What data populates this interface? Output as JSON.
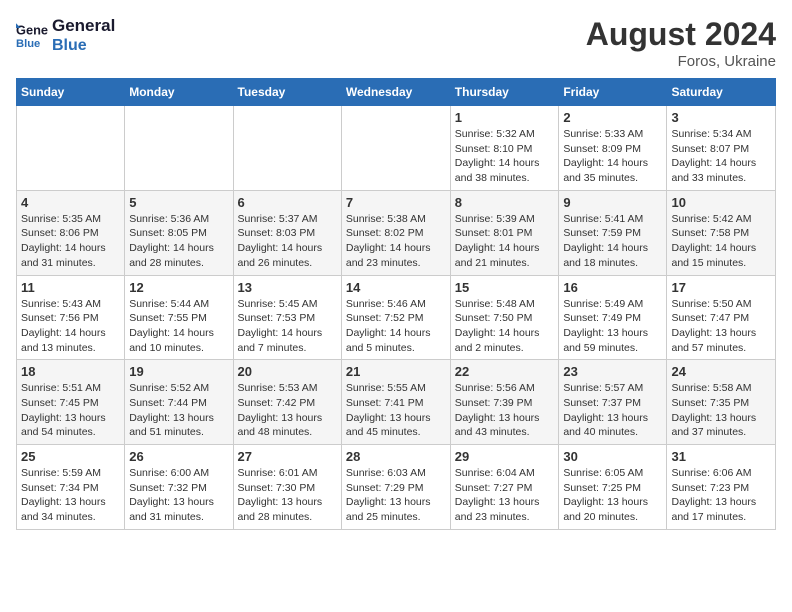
{
  "header": {
    "logo_line1": "General",
    "logo_line2": "Blue",
    "month_year": "August 2024",
    "location": "Foros, Ukraine"
  },
  "weekdays": [
    "Sunday",
    "Monday",
    "Tuesday",
    "Wednesday",
    "Thursday",
    "Friday",
    "Saturday"
  ],
  "weeks": [
    [
      {
        "num": "",
        "sunrise": "",
        "sunset": "",
        "daylight": ""
      },
      {
        "num": "",
        "sunrise": "",
        "sunset": "",
        "daylight": ""
      },
      {
        "num": "",
        "sunrise": "",
        "sunset": "",
        "daylight": ""
      },
      {
        "num": "",
        "sunrise": "",
        "sunset": "",
        "daylight": ""
      },
      {
        "num": "1",
        "sunrise": "Sunrise: 5:32 AM",
        "sunset": "Sunset: 8:10 PM",
        "daylight": "Daylight: 14 hours and 38 minutes."
      },
      {
        "num": "2",
        "sunrise": "Sunrise: 5:33 AM",
        "sunset": "Sunset: 8:09 PM",
        "daylight": "Daylight: 14 hours and 35 minutes."
      },
      {
        "num": "3",
        "sunrise": "Sunrise: 5:34 AM",
        "sunset": "Sunset: 8:07 PM",
        "daylight": "Daylight: 14 hours and 33 minutes."
      }
    ],
    [
      {
        "num": "4",
        "sunrise": "Sunrise: 5:35 AM",
        "sunset": "Sunset: 8:06 PM",
        "daylight": "Daylight: 14 hours and 31 minutes."
      },
      {
        "num": "5",
        "sunrise": "Sunrise: 5:36 AM",
        "sunset": "Sunset: 8:05 PM",
        "daylight": "Daylight: 14 hours and 28 minutes."
      },
      {
        "num": "6",
        "sunrise": "Sunrise: 5:37 AM",
        "sunset": "Sunset: 8:03 PM",
        "daylight": "Daylight: 14 hours and 26 minutes."
      },
      {
        "num": "7",
        "sunrise": "Sunrise: 5:38 AM",
        "sunset": "Sunset: 8:02 PM",
        "daylight": "Daylight: 14 hours and 23 minutes."
      },
      {
        "num": "8",
        "sunrise": "Sunrise: 5:39 AM",
        "sunset": "Sunset: 8:01 PM",
        "daylight": "Daylight: 14 hours and 21 minutes."
      },
      {
        "num": "9",
        "sunrise": "Sunrise: 5:41 AM",
        "sunset": "Sunset: 7:59 PM",
        "daylight": "Daylight: 14 hours and 18 minutes."
      },
      {
        "num": "10",
        "sunrise": "Sunrise: 5:42 AM",
        "sunset": "Sunset: 7:58 PM",
        "daylight": "Daylight: 14 hours and 15 minutes."
      }
    ],
    [
      {
        "num": "11",
        "sunrise": "Sunrise: 5:43 AM",
        "sunset": "Sunset: 7:56 PM",
        "daylight": "Daylight: 14 hours and 13 minutes."
      },
      {
        "num": "12",
        "sunrise": "Sunrise: 5:44 AM",
        "sunset": "Sunset: 7:55 PM",
        "daylight": "Daylight: 14 hours and 10 minutes."
      },
      {
        "num": "13",
        "sunrise": "Sunrise: 5:45 AM",
        "sunset": "Sunset: 7:53 PM",
        "daylight": "Daylight: 14 hours and 7 minutes."
      },
      {
        "num": "14",
        "sunrise": "Sunrise: 5:46 AM",
        "sunset": "Sunset: 7:52 PM",
        "daylight": "Daylight: 14 hours and 5 minutes."
      },
      {
        "num": "15",
        "sunrise": "Sunrise: 5:48 AM",
        "sunset": "Sunset: 7:50 PM",
        "daylight": "Daylight: 14 hours and 2 minutes."
      },
      {
        "num": "16",
        "sunrise": "Sunrise: 5:49 AM",
        "sunset": "Sunset: 7:49 PM",
        "daylight": "Daylight: 13 hours and 59 minutes."
      },
      {
        "num": "17",
        "sunrise": "Sunrise: 5:50 AM",
        "sunset": "Sunset: 7:47 PM",
        "daylight": "Daylight: 13 hours and 57 minutes."
      }
    ],
    [
      {
        "num": "18",
        "sunrise": "Sunrise: 5:51 AM",
        "sunset": "Sunset: 7:45 PM",
        "daylight": "Daylight: 13 hours and 54 minutes."
      },
      {
        "num": "19",
        "sunrise": "Sunrise: 5:52 AM",
        "sunset": "Sunset: 7:44 PM",
        "daylight": "Daylight: 13 hours and 51 minutes."
      },
      {
        "num": "20",
        "sunrise": "Sunrise: 5:53 AM",
        "sunset": "Sunset: 7:42 PM",
        "daylight": "Daylight: 13 hours and 48 minutes."
      },
      {
        "num": "21",
        "sunrise": "Sunrise: 5:55 AM",
        "sunset": "Sunset: 7:41 PM",
        "daylight": "Daylight: 13 hours and 45 minutes."
      },
      {
        "num": "22",
        "sunrise": "Sunrise: 5:56 AM",
        "sunset": "Sunset: 7:39 PM",
        "daylight": "Daylight: 13 hours and 43 minutes."
      },
      {
        "num": "23",
        "sunrise": "Sunrise: 5:57 AM",
        "sunset": "Sunset: 7:37 PM",
        "daylight": "Daylight: 13 hours and 40 minutes."
      },
      {
        "num": "24",
        "sunrise": "Sunrise: 5:58 AM",
        "sunset": "Sunset: 7:35 PM",
        "daylight": "Daylight: 13 hours and 37 minutes."
      }
    ],
    [
      {
        "num": "25",
        "sunrise": "Sunrise: 5:59 AM",
        "sunset": "Sunset: 7:34 PM",
        "daylight": "Daylight: 13 hours and 34 minutes."
      },
      {
        "num": "26",
        "sunrise": "Sunrise: 6:00 AM",
        "sunset": "Sunset: 7:32 PM",
        "daylight": "Daylight: 13 hours and 31 minutes."
      },
      {
        "num": "27",
        "sunrise": "Sunrise: 6:01 AM",
        "sunset": "Sunset: 7:30 PM",
        "daylight": "Daylight: 13 hours and 28 minutes."
      },
      {
        "num": "28",
        "sunrise": "Sunrise: 6:03 AM",
        "sunset": "Sunset: 7:29 PM",
        "daylight": "Daylight: 13 hours and 25 minutes."
      },
      {
        "num": "29",
        "sunrise": "Sunrise: 6:04 AM",
        "sunset": "Sunset: 7:27 PM",
        "daylight": "Daylight: 13 hours and 23 minutes."
      },
      {
        "num": "30",
        "sunrise": "Sunrise: 6:05 AM",
        "sunset": "Sunset: 7:25 PM",
        "daylight": "Daylight: 13 hours and 20 minutes."
      },
      {
        "num": "31",
        "sunrise": "Sunrise: 6:06 AM",
        "sunset": "Sunset: 7:23 PM",
        "daylight": "Daylight: 13 hours and 17 minutes."
      }
    ]
  ]
}
